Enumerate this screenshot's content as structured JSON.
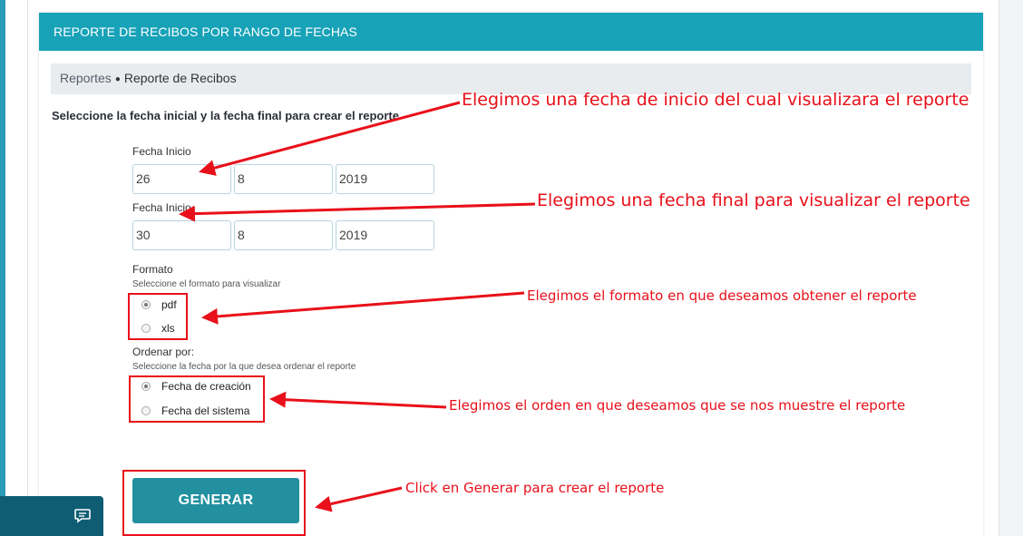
{
  "header": {
    "title": "REPORTE DE RECIBOS POR RANGO DE FECHAS"
  },
  "breadcrumb": {
    "items": [
      "Reportes",
      "Reporte de Recibos"
    ],
    "separator": "●"
  },
  "form": {
    "instructions": "Seleccione la fecha inicial y la fecha final para crear el reporte",
    "start_label": "Fecha Inicio",
    "start_day": "26",
    "start_month": "8",
    "start_year": "2019",
    "end_label": "Fecha Inicio",
    "end_day": "30",
    "end_month": "8",
    "end_year": "2019",
    "format_label": "Formato",
    "format_help": "Seleccione el formato para visualizar",
    "format_options": [
      "pdf",
      "xls"
    ],
    "format_selected": "pdf",
    "order_label": "Ordenar por:",
    "order_help": "Seleccione la fecha por la que desea ordenar el reporte",
    "order_options": [
      "Fecha de creación",
      "Fecha del sistema"
    ],
    "order_selected": "Fecha de creación",
    "generate_label": "GENERAR"
  },
  "annotations": {
    "start": "Elegimos una fecha de inicio del cual visualizara el reporte",
    "end": "Elegimos una fecha final para visualizar el reporte",
    "format": "Elegimos el formato en que deseamos obtener el reporte",
    "order": "Elegimos el orden en que deseamos que se nos muestre el reporte",
    "generate": "Click en Generar para crear el reporte"
  },
  "colors": {
    "header_bg": "#17a2b8",
    "button_bg": "#23909f",
    "annotation": "#e8101a",
    "chat_bg": "#0f5d72"
  },
  "icons": {
    "chat": "chat-icon"
  }
}
